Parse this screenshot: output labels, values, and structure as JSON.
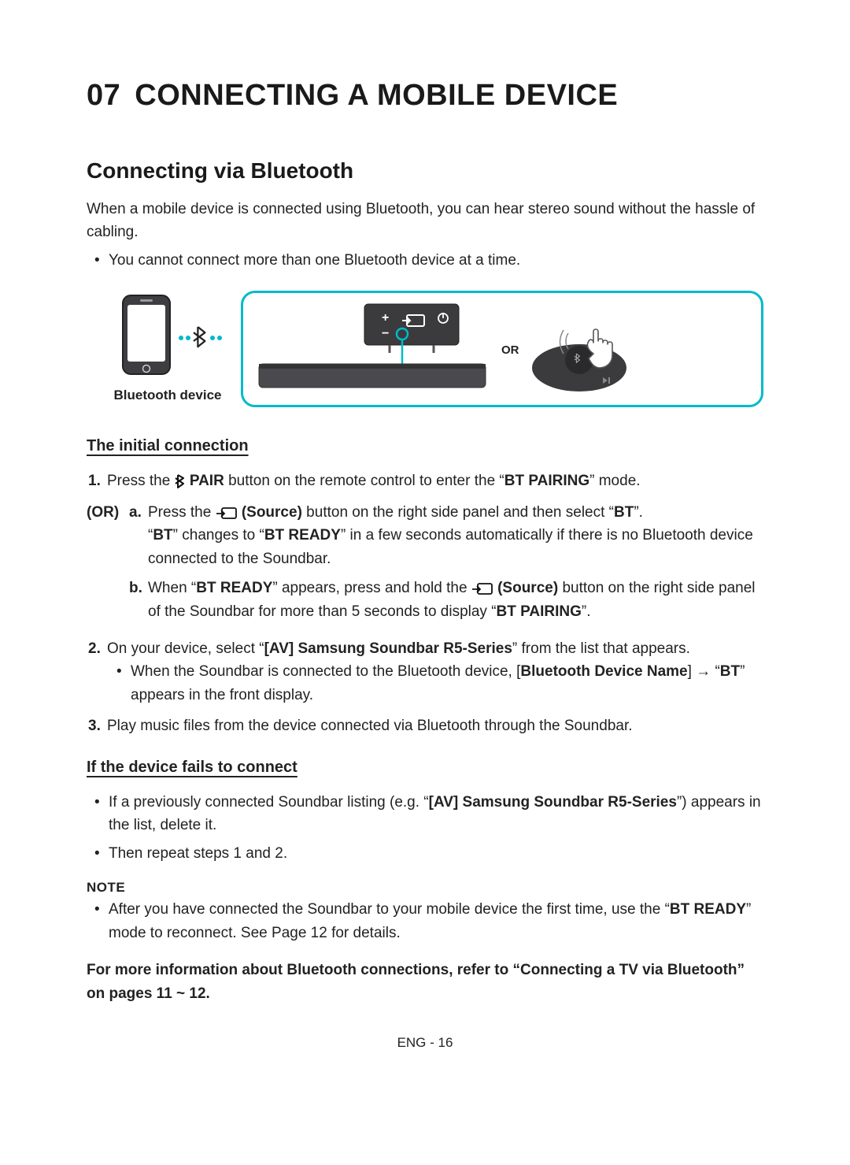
{
  "chapter": {
    "number": "07",
    "title": "CONNECTING A MOBILE DEVICE"
  },
  "section_title": "Connecting via Bluetooth",
  "intro_paragraph": "When a mobile device is connected using Bluetooth, you can hear stereo sound without the hassle of cabling.",
  "intro_bullet": "You cannot connect more than one Bluetooth device at a time.",
  "diagram": {
    "phone_label": "Bluetooth device",
    "or_label": "OR"
  },
  "sub1_heading": "The initial connection",
  "step1": {
    "prefix": "Press the ",
    "pair_label": " PAIR",
    "middle": " button on the remote control to enter the “",
    "bold1": "BT PAIRING",
    "suffix": "” mode."
  },
  "or_header": "(OR)",
  "step_a": {
    "letter": "a.",
    "t1": "Press the ",
    "source_bold": " (Source)",
    "t2": " button on the right side panel and then select “",
    "bt_bold": "BT",
    "t3": "”.",
    "line2_pre": "“",
    "line2_bt": "BT",
    "line2_mid": "” changes to “",
    "line2_ready": "BT READY",
    "line2_post": "” in a few seconds automatically if there is no Bluetooth device connected to the Soundbar."
  },
  "step_b": {
    "letter": "b.",
    "t1": "When “",
    "ready": "BT READY",
    "t2": "” appears, press and hold the ",
    "source_bold": " (Source)",
    "t3": " button on the right side panel of the Soundbar for more than 5 seconds to display “",
    "pairing": "BT PAIRING",
    "t4": "”."
  },
  "step2": {
    "t1": "On your device, select “",
    "bold": "[AV] Samsung Soundbar R5-Series",
    "t2": "” from the list that appears.",
    "sub_t1": "When the Soundbar is connected to the Bluetooth device, [",
    "sub_bold1": "Bluetooth Device Name",
    "sub_t2": "] → “",
    "sub_bold2": "BT",
    "sub_t3": "” appears in the front display."
  },
  "step3": "Play music files from the device connected via Bluetooth through the Soundbar.",
  "sub2_heading": "If the device fails to connect",
  "fail_b1": {
    "t1": "If a previously connected Soundbar listing (e.g. “",
    "bold": "[AV] Samsung Soundbar R5-Series",
    "t2": "”) appears in the list, delete it."
  },
  "fail_b2": "Then repeat steps 1 and 2.",
  "note_label": "NOTE",
  "note_bullet": {
    "t1": "After you have connected the Soundbar to your mobile device the first time, use the “",
    "bold": "BT READY",
    "t2": "” mode to reconnect. See Page 12 for details."
  },
  "xref": "For more information about Bluetooth connections, refer to “Connecting a TV via Bluetooth” on pages 11 ~ 12.",
  "footer": "ENG - 16"
}
